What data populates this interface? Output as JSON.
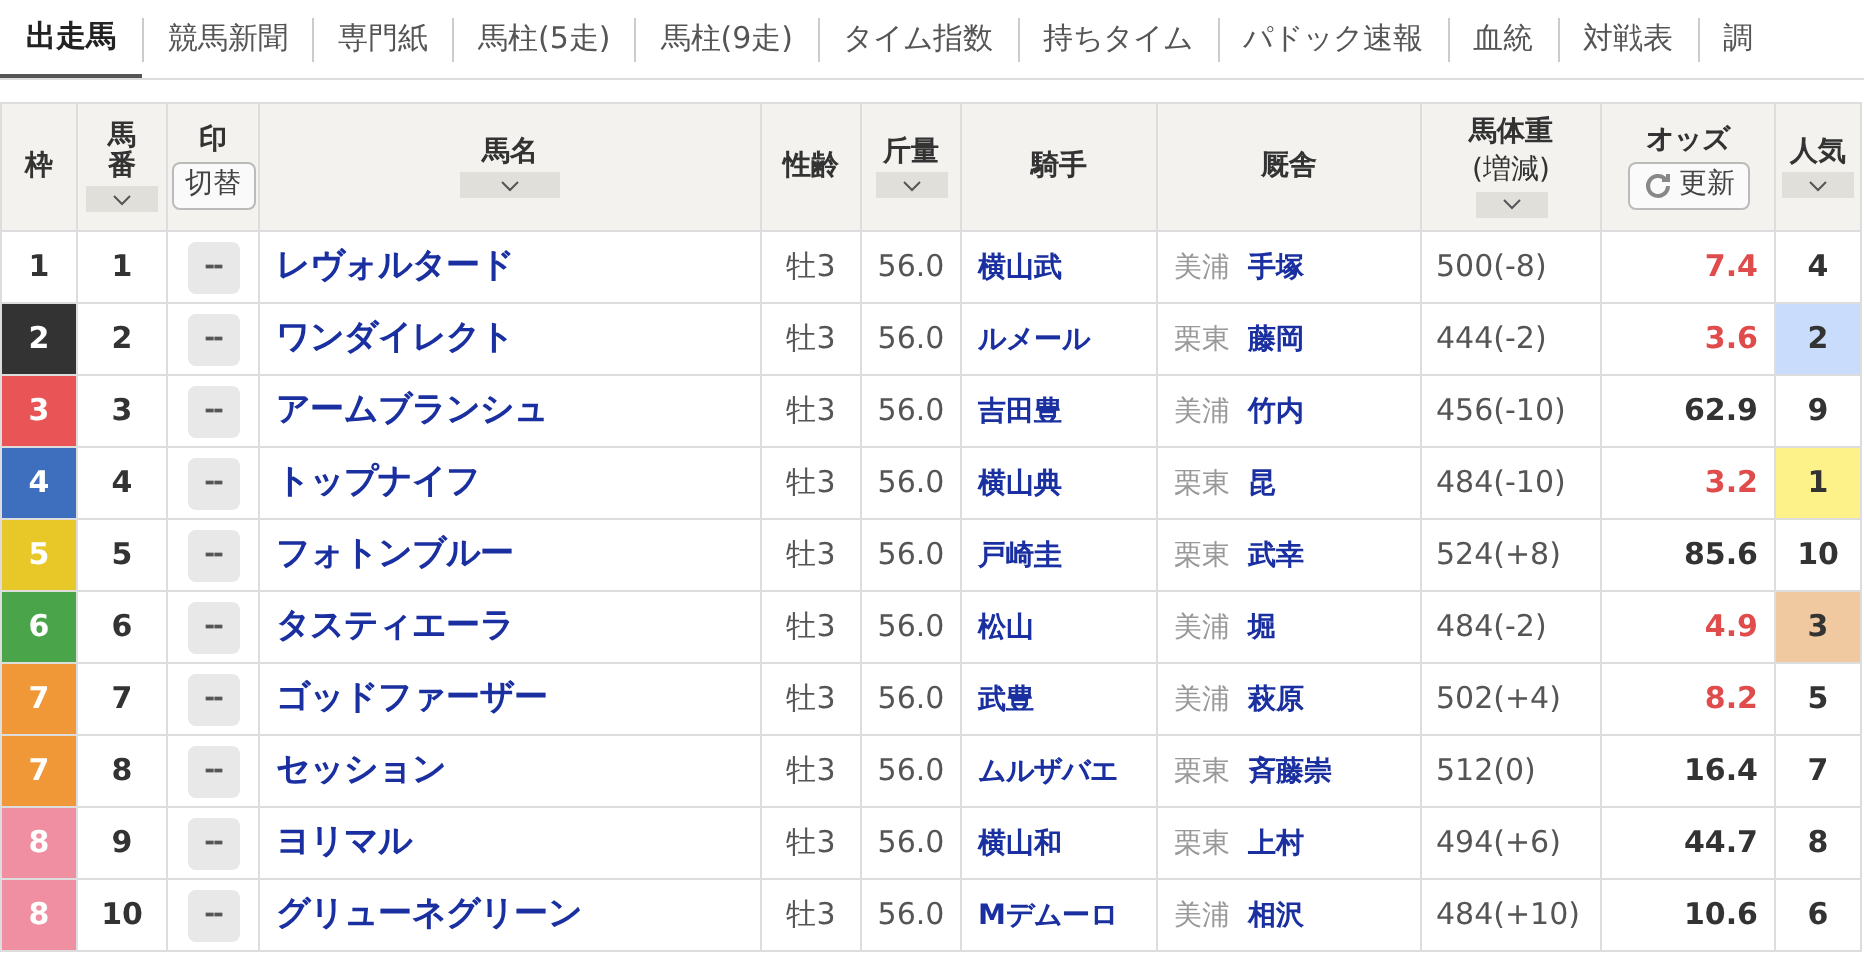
{
  "tabs": [
    {
      "label": "出走馬",
      "selected": true
    },
    {
      "label": "競馬新聞",
      "selected": false
    },
    {
      "label": "専門紙",
      "selected": false
    },
    {
      "label": "馬柱(5走)",
      "selected": false
    },
    {
      "label": "馬柱(9走)",
      "selected": false
    },
    {
      "label": "タイム指数",
      "selected": false
    },
    {
      "label": "持ちタイム",
      "selected": false
    },
    {
      "label": "パドック速報",
      "selected": false
    },
    {
      "label": "血統",
      "selected": false
    },
    {
      "label": "対戦表",
      "selected": false
    },
    {
      "label": "調",
      "selected": false
    }
  ],
  "table": {
    "columns": [
      {
        "label": "枠",
        "sortable": false
      },
      {
        "label": "馬番",
        "sortable": true
      },
      {
        "label": "印",
        "sortable": false,
        "button": "切替"
      },
      {
        "label": "馬名",
        "sortable": true
      },
      {
        "label": "性齢",
        "sortable": false
      },
      {
        "label": "斤量",
        "sortable": true
      },
      {
        "label": "騎手",
        "sortable": false
      },
      {
        "label": "厩舎",
        "sortable": false
      },
      {
        "label": "馬体重",
        "sub": "(増減)",
        "sortable": true
      },
      {
        "label": "オッズ",
        "sortable": false,
        "button": "更新"
      },
      {
        "label": "人気",
        "sortable": true
      }
    ],
    "rows": [
      {
        "frame": {
          "number": "1",
          "color": "#ffffff"
        },
        "number": "1",
        "mark": "--",
        "name": "レヴォルタード",
        "sex_age": "牡3",
        "weight": "56.0",
        "jockey": "横山武",
        "region": "美浦",
        "trainer": "手塚",
        "body_weight": "500(-8)",
        "odds": "7.4",
        "odds_hot": true,
        "popularity": {
          "rank": "4"
        }
      },
      {
        "frame": {
          "number": "2",
          "color": "#333333"
        },
        "number": "2",
        "mark": "--",
        "name": "ワンダイレクト",
        "sex_age": "牡3",
        "weight": "56.0",
        "jockey": "ルメール",
        "region": "栗東",
        "trainer": "藤岡",
        "body_weight": "444(-2)",
        "odds": "3.6",
        "odds_hot": true,
        "popularity": {
          "rank": "2",
          "color": "#cadcfb"
        }
      },
      {
        "frame": {
          "number": "3",
          "color": "#e95556"
        },
        "number": "3",
        "mark": "--",
        "name": "アームブランシュ",
        "sex_age": "牡3",
        "weight": "56.0",
        "jockey": "吉田豊",
        "region": "美浦",
        "trainer": "竹内",
        "body_weight": "456(-10)",
        "odds": "62.9",
        "odds_hot": false,
        "popularity": {
          "rank": "9"
        }
      },
      {
        "frame": {
          "number": "4",
          "color": "#3e6fbf"
        },
        "number": "4",
        "mark": "--",
        "name": "トップナイフ",
        "sex_age": "牡3",
        "weight": "56.0",
        "jockey": "横山典",
        "region": "栗東",
        "trainer": "昆",
        "body_weight": "484(-10)",
        "odds": "3.2",
        "odds_hot": true,
        "popularity": {
          "rank": "1",
          "color": "#fdf28a"
        }
      },
      {
        "frame": {
          "number": "5",
          "color": "#e8c829"
        },
        "number": "5",
        "mark": "--",
        "name": "フォトンブルー",
        "sex_age": "牡3",
        "weight": "56.0",
        "jockey": "戸崎圭",
        "region": "栗東",
        "trainer": "武幸",
        "body_weight": "524(+8)",
        "odds": "85.6",
        "odds_hot": false,
        "popularity": {
          "rank": "10"
        }
      },
      {
        "frame": {
          "number": "6",
          "color": "#4aa54a"
        },
        "number": "6",
        "mark": "--",
        "name": "タスティエーラ",
        "sex_age": "牡3",
        "weight": "56.0",
        "jockey": "松山",
        "region": "美浦",
        "trainer": "堀",
        "body_weight": "484(-2)",
        "odds": "4.9",
        "odds_hot": true,
        "popularity": {
          "rank": "3",
          "color": "#f1c9a0"
        }
      },
      {
        "frame": {
          "number": "7",
          "color": "#f09838"
        },
        "number": "7",
        "mark": "--",
        "name": "ゴッドファーザー",
        "sex_age": "牡3",
        "weight": "56.0",
        "jockey": "武豊",
        "region": "美浦",
        "trainer": "萩原",
        "body_weight": "502(+4)",
        "odds": "8.2",
        "odds_hot": true,
        "popularity": {
          "rank": "5"
        }
      },
      {
        "frame": {
          "number": "7",
          "color": "#f09838"
        },
        "number": "8",
        "mark": "--",
        "name": "セッション",
        "sex_age": "牡3",
        "weight": "56.0",
        "jockey": "ムルザバエ",
        "region": "栗東",
        "trainer": "斉藤崇",
        "body_weight": "512(0)",
        "odds": "16.4",
        "odds_hot": false,
        "popularity": {
          "rank": "7"
        }
      },
      {
        "frame": {
          "number": "8",
          "color": "#f08fa2"
        },
        "number": "9",
        "mark": "--",
        "name": "ヨリマル",
        "sex_age": "牡3",
        "weight": "56.0",
        "jockey": "横山和",
        "region": "栗東",
        "trainer": "上村",
        "body_weight": "494(+6)",
        "odds": "44.7",
        "odds_hot": false,
        "popularity": {
          "rank": "8"
        }
      },
      {
        "frame": {
          "number": "8",
          "color": "#f08fa2"
        },
        "number": "10",
        "mark": "--",
        "name": "グリューネグリーン",
        "sex_age": "牡3",
        "weight": "56.0",
        "jockey": "Mデムーロ",
        "region": "美浦",
        "trainer": "相沢",
        "body_weight": "484(+10)",
        "odds": "10.6",
        "odds_hot": false,
        "popularity": {
          "rank": "6"
        }
      }
    ]
  }
}
